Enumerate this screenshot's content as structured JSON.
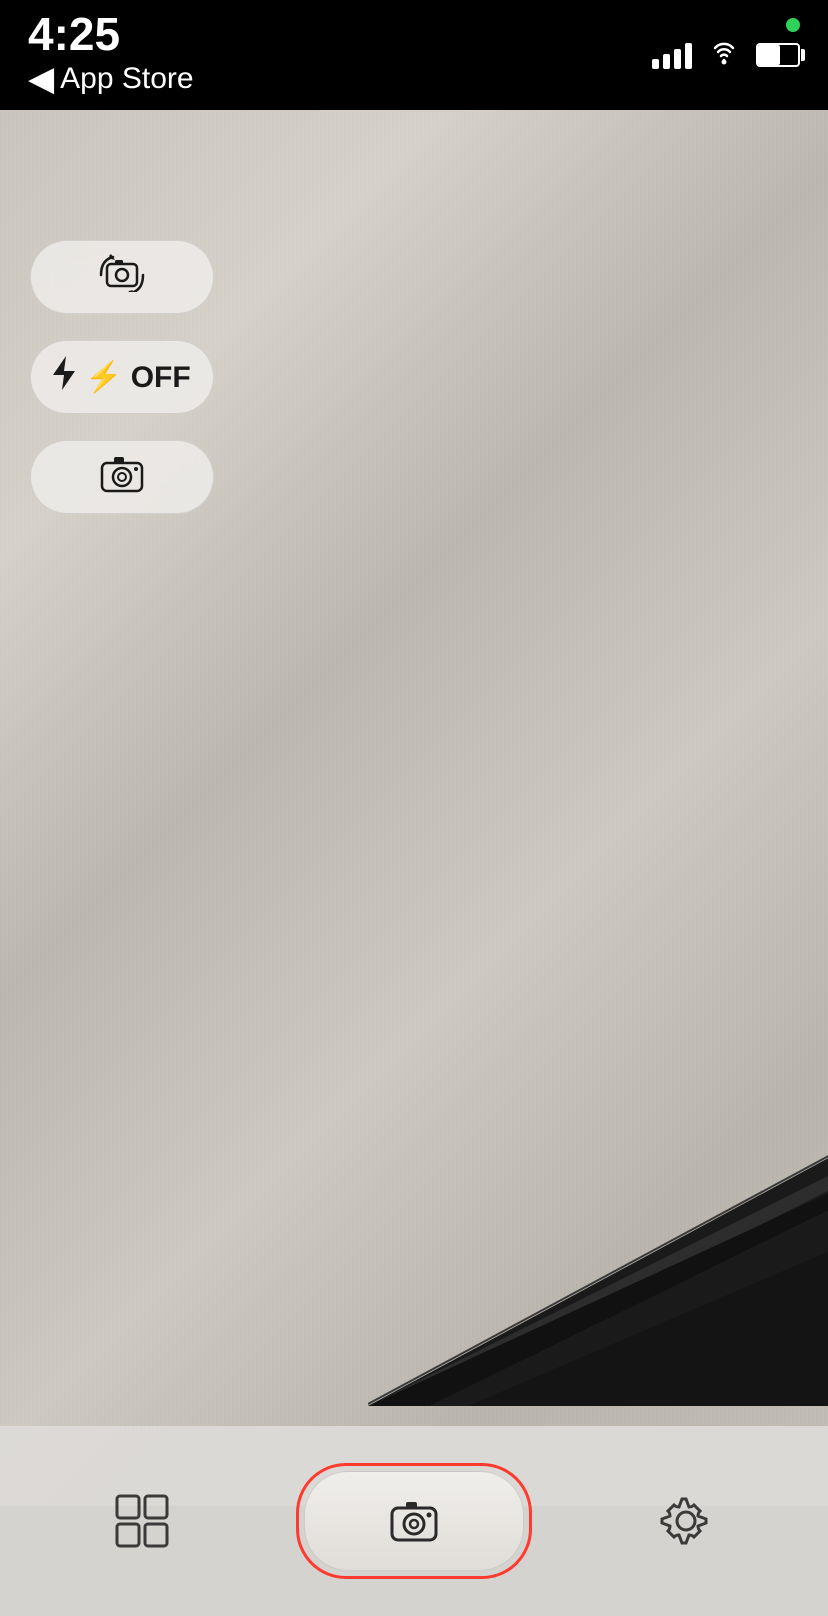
{
  "statusBar": {
    "time": "4:25",
    "backLabel": "App Store",
    "greenDot": true
  },
  "controls": {
    "switchCameraLabel": "",
    "flashLabel": "⚡ OFF",
    "photoLabel": ""
  },
  "bottomBar": {
    "captureLabel": "",
    "settingsLabel": ""
  }
}
